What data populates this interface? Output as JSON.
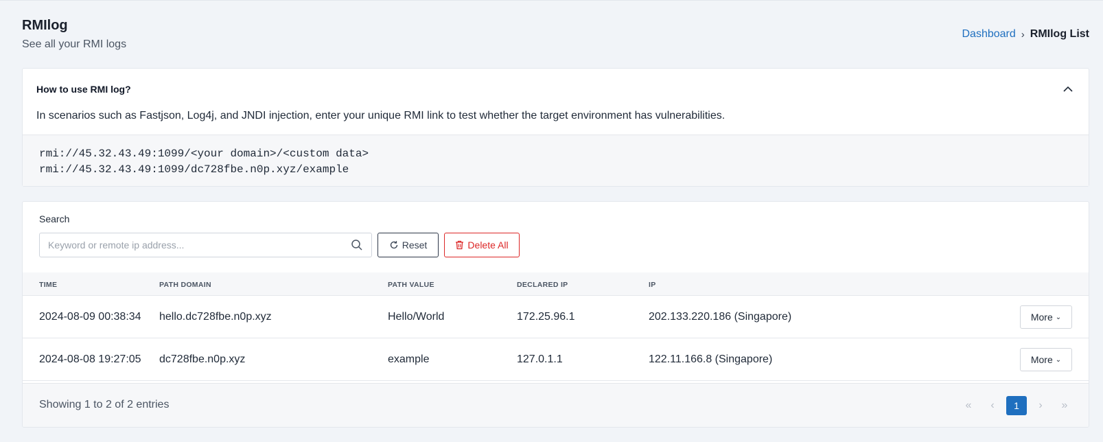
{
  "header": {
    "title": "RMIlog",
    "subtitle": "See all your RMI logs"
  },
  "breadcrumb": {
    "home": "Dashboard",
    "separator": "›",
    "current": "RMIlog List"
  },
  "help": {
    "title": "How to use RMI log?",
    "description": "In scenarios such as Fastjson, Log4j, and JNDI injection, enter your unique RMI link to test whether the target environment has vulnerabilities.",
    "code_lines": [
      "rmi://45.32.43.49:1099/<your domain>/<custom data>",
      "rmi://45.32.43.49:1099/dc728fbe.n0p.xyz/example"
    ],
    "expanded": true
  },
  "search": {
    "label": "Search",
    "placeholder": "Keyword or remote ip address...",
    "value": "",
    "reset_label": "Reset",
    "delete_all_label": "Delete All"
  },
  "table": {
    "columns": [
      "TIME",
      "PATH DOMAIN",
      "PATH VALUE",
      "DECLARED IP",
      "IP"
    ],
    "rows": [
      {
        "time": "2024-08-09 00:38:34",
        "path_domain": "hello.dc728fbe.n0p.xyz",
        "path_value": "Hello/World",
        "declared_ip": "172.25.96.1",
        "ip": "202.133.220.186 (Singapore)",
        "action": "More"
      },
      {
        "time": "2024-08-08 19:27:05",
        "path_domain": "dc728fbe.n0p.xyz",
        "path_value": "example",
        "declared_ip": "127.0.1.1",
        "ip": "122.11.166.8 (Singapore)",
        "action": "More"
      }
    ]
  },
  "footer": {
    "info": "Showing 1 to 2 of 2 entries",
    "pagination": {
      "first": "«",
      "prev": "‹",
      "current_page": "1",
      "next": "›",
      "last": "»"
    }
  },
  "colors": {
    "accent": "#1f6fbf",
    "danger": "#dc2626",
    "background": "#f1f4f8"
  }
}
